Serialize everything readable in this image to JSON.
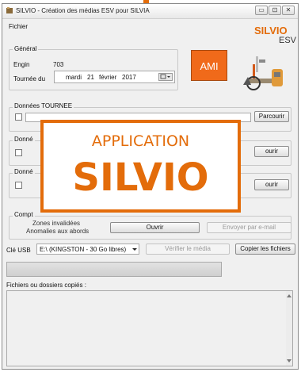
{
  "colors": {
    "brand_orange": "#e36c0a",
    "ami_fill": "#f06a1a",
    "brand_title": "#e36c0a"
  },
  "window": {
    "title": "SILVIO - Création des médias ESV pour SILVIA",
    "controls": {
      "minimize": "▭",
      "maximize": "⊡",
      "close": "✕"
    }
  },
  "menu": {
    "fichier": "Fichier"
  },
  "brand": {
    "name": "SILVIO",
    "sub": "ESV"
  },
  "general": {
    "legend": "Général",
    "engin_label": "Engin",
    "engin_value": "703",
    "tournee_label": "Tournée du",
    "date_day": "mardi",
    "date_num": "21",
    "date_month": "février",
    "date_year": "2017",
    "ami_label": "AMI"
  },
  "tournee": {
    "legend": "Données TOURNEE",
    "browse": "Parcourir"
  },
  "section2": {
    "legend": "Donné",
    "browse": "ourir"
  },
  "section3": {
    "legend": "Donné",
    "browse": "ourir"
  },
  "compte": {
    "legend": "Compt",
    "line1": "Zones invalidées",
    "line2": "Anomalies aux abords",
    "open": "Ouvrir",
    "email": "Envoyer par e-mail"
  },
  "usb": {
    "label": "Clé USB",
    "drive": "E:\\ (KINGSTON - 30 Go libres)",
    "verify": "Vérifier le média",
    "copy": "Copier les fichiers"
  },
  "copied": {
    "label": "Fichiers ou dossiers copiés :"
  },
  "overlay": {
    "line1": "APPLICATION",
    "line2": "SILVIO"
  },
  "icons": [
    "app-icon",
    "checkbox",
    "dropdown-arrow-icon",
    "scroll-up-icon",
    "scroll-down-icon",
    "equipment-illustration-icon"
  ]
}
